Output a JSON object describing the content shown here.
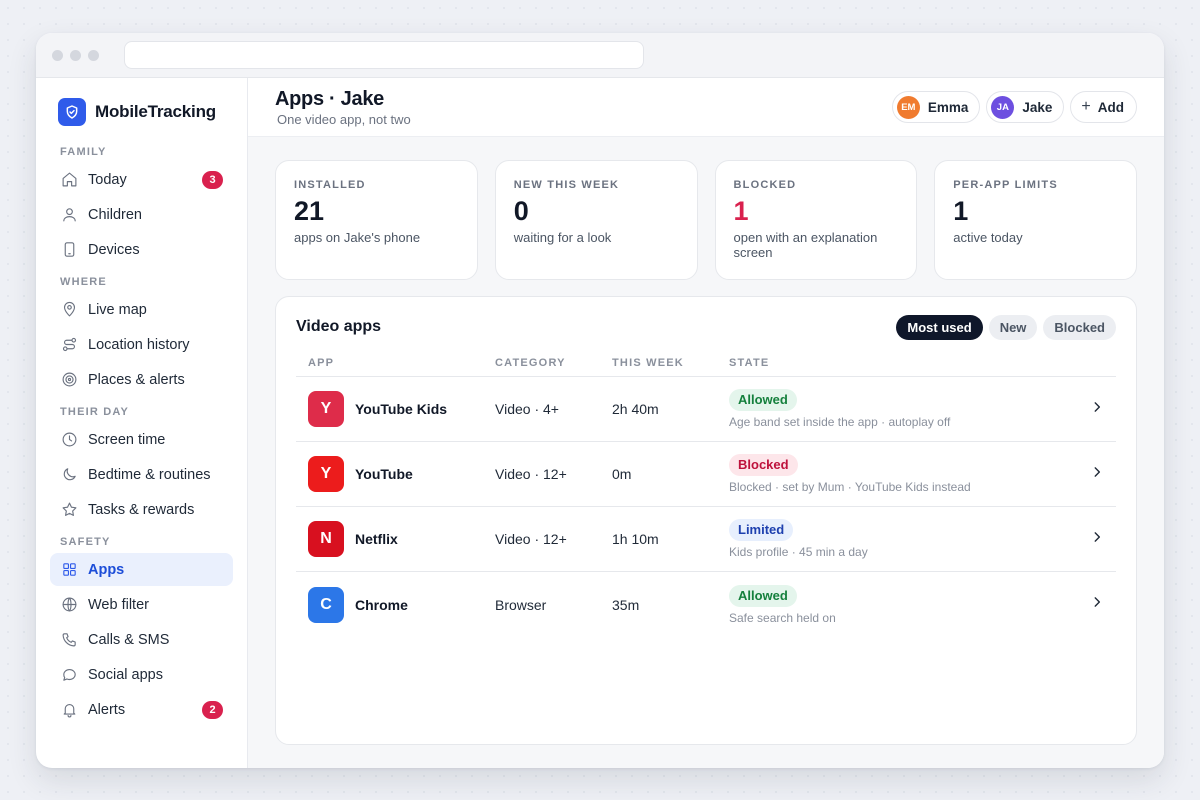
{
  "brand": {
    "name": "MobileTracking"
  },
  "sidebar": {
    "sections": [
      {
        "label": "FAMILY",
        "items": [
          {
            "label": "Today",
            "icon": "home-icon",
            "badge": "3"
          },
          {
            "label": "Children",
            "icon": "user-icon"
          },
          {
            "label": "Devices",
            "icon": "phone-icon"
          }
        ]
      },
      {
        "label": "WHERE",
        "items": [
          {
            "label": "Live map",
            "icon": "map-pin-icon"
          },
          {
            "label": "Location history",
            "icon": "route-icon"
          },
          {
            "label": "Places & alerts",
            "icon": "target-icon"
          }
        ]
      },
      {
        "label": "THEIR DAY",
        "items": [
          {
            "label": "Screen time",
            "icon": "clock-icon"
          },
          {
            "label": "Bedtime & routines",
            "icon": "moon-icon"
          },
          {
            "label": "Tasks & rewards",
            "icon": "star-icon"
          }
        ]
      },
      {
        "label": "SAFETY",
        "items": [
          {
            "label": "Apps",
            "icon": "grid-icon",
            "active": true
          },
          {
            "label": "Web filter",
            "icon": "globe-icon"
          },
          {
            "label": "Calls & SMS",
            "icon": "phone-call-icon"
          },
          {
            "label": "Social apps",
            "icon": "chat-icon"
          },
          {
            "label": "Alerts",
            "icon": "bell-icon",
            "badge": "2"
          }
        ]
      }
    ]
  },
  "header": {
    "title": "Apps · Jake",
    "subtitle": "One video app, not two",
    "profiles": [
      {
        "initials": "EM",
        "name": "Emma",
        "color": "#f07b2f"
      },
      {
        "initials": "JA",
        "name": "Jake",
        "color": "#6d4fe0"
      }
    ],
    "add_label": "Add"
  },
  "stats": [
    {
      "label": "INSTALLED",
      "value": "21",
      "desc": "apps on Jake's phone",
      "color": "#111827"
    },
    {
      "label": "NEW THIS WEEK",
      "value": "0",
      "desc": "waiting for a look",
      "color": "#111827"
    },
    {
      "label": "BLOCKED",
      "value": "1",
      "desc": "open with an explanation screen",
      "color": "#d9214e"
    },
    {
      "label": "PER-APP LIMITS",
      "value": "1",
      "desc": "active today",
      "color": "#111827"
    }
  ],
  "panel": {
    "title": "Video apps",
    "filters": [
      "Most used",
      "New",
      "Blocked"
    ],
    "active_filter": 0,
    "columns": [
      "APP",
      "CATEGORY",
      "THIS WEEK",
      "STATE"
    ],
    "rows": [
      {
        "letter": "Y",
        "color": "#de2c4a",
        "name": "YouTube Kids",
        "category": "Video · 4+",
        "week": "2h 40m",
        "state": "Allowed",
        "state_class": "st-allowed",
        "note": "Age band set inside the app · autoplay off"
      },
      {
        "letter": "Y",
        "color": "#ec1c1c",
        "name": "YouTube",
        "category": "Video · 12+",
        "week": "0m",
        "state": "Blocked",
        "state_class": "st-blocked",
        "note": "Blocked · set by Mum · YouTube Kids instead"
      },
      {
        "letter": "N",
        "color": "#d8101f",
        "name": "Netflix",
        "category": "Video · 12+",
        "week": "1h 10m",
        "state": "Limited",
        "state_class": "st-limited",
        "note": "Kids profile · 45 min a day"
      },
      {
        "letter": "C",
        "color": "#2c77e8",
        "name": "Chrome",
        "category": "Browser",
        "week": "35m",
        "state": "Allowed",
        "state_class": "st-allowed",
        "note": "Safe search held on"
      }
    ]
  }
}
